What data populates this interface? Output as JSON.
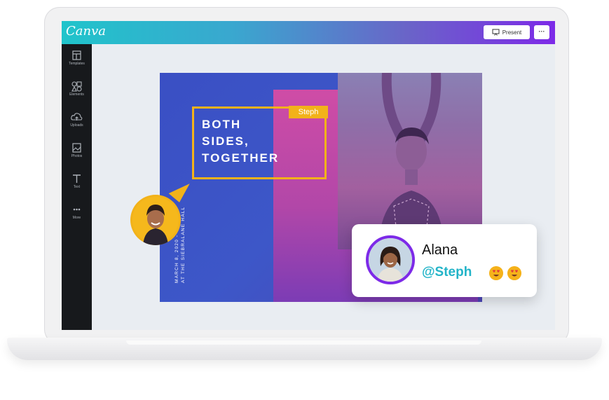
{
  "app": {
    "logo": "Canva",
    "present_label": "Present",
    "more_label": "···"
  },
  "sidebar": {
    "items": [
      {
        "label": "Templates",
        "icon": "templates-icon"
      },
      {
        "label": "Elements",
        "icon": "elements-icon"
      },
      {
        "label": "Uploads",
        "icon": "uploads-icon"
      },
      {
        "label": "Photos",
        "icon": "photos-icon"
      },
      {
        "label": "Text",
        "icon": "text-icon"
      },
      {
        "label": "More",
        "icon": "more-icon"
      }
    ]
  },
  "design": {
    "headline": [
      "BOTH",
      "SIDES,",
      "TOGETHER"
    ],
    "collaborator_tag": "Steph",
    "event_lines": [
      "MARCH 8, 2020 - 4:00 PM",
      "AT THE SIEBRALANE HALL"
    ]
  },
  "comment": {
    "name": "Alana",
    "mention": "@Steph"
  },
  "colors": {
    "brand_gradient_start": "#20c4cb",
    "brand_gradient_end": "#7d2ae8",
    "highlight": "#f2b21a",
    "mention": "#23b4c8"
  }
}
